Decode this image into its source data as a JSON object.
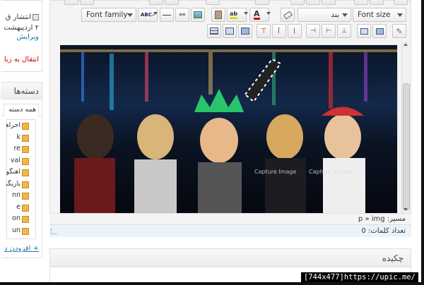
{
  "publish_box": {
    "date_line": "انتشار ق",
    "date_value": "۲ اردیبهشت",
    "edit_link": "ویرایش",
    "trash_link": "انتقال به زبا"
  },
  "categories": {
    "title": "دسته‌ها",
    "tab_all": "همه دسته",
    "items": [
      {
        "label": "اجراها"
      },
      {
        "label": "k"
      },
      {
        "label": "re"
      },
      {
        "label": "val"
      },
      {
        "label": "اهنگو"
      },
      {
        "label": "بازیگرا"
      },
      {
        "label": "nn"
      },
      {
        "label": "e"
      },
      {
        "label": "on"
      },
      {
        "label": "un"
      }
    ],
    "add_link": "+ افزودن د"
  },
  "toolbar": {
    "font_family": "Font family",
    "font_size": "Font size",
    "format_select": "بند"
  },
  "editor": {
    "path_label": "مسیر:",
    "path_value": "p » img",
    "word_count_label": "تعداد کلمات:",
    "word_count": "0",
    "overlay_left": "Capture Image",
    "overlay_right": "Capture Screen"
  },
  "excerpt": {
    "title": "چکیده"
  },
  "watermark": "[744x477]https://upic.me/"
}
